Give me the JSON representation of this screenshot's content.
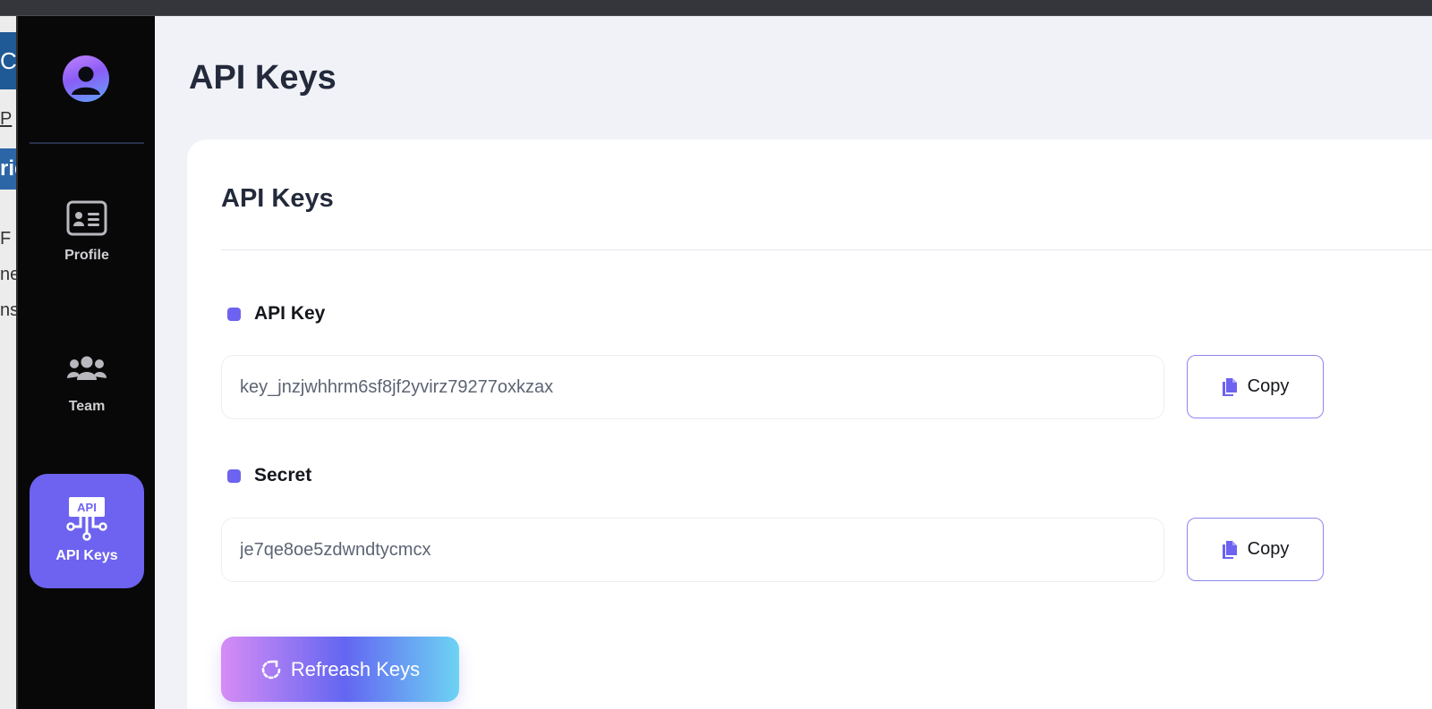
{
  "page": {
    "title": "API Keys"
  },
  "background_window": {
    "fragments": [
      "CO",
      "P",
      "rie",
      "F",
      "ne",
      "ns"
    ]
  },
  "sidebar": {
    "avatar_icon": "user-avatar-icon",
    "items": [
      {
        "label": "Profile",
        "icon": "id-card-icon",
        "active": false
      },
      {
        "label": "Team",
        "icon": "users-icon",
        "active": false
      },
      {
        "label": "API Keys",
        "icon": "api-icon",
        "icon_text": "API",
        "active": true
      }
    ]
  },
  "card": {
    "title": "API Keys",
    "fields": [
      {
        "label": "API Key",
        "value": "key_jnzjwhhrm6sf8jf2yvirz79277oxkzax",
        "copy_label": "Copy"
      },
      {
        "label": "Secret",
        "value": "je7qe8oe5zdwndtycmcx",
        "copy_label": "Copy"
      }
    ],
    "refresh_label": "Refreash Keys"
  },
  "colors": {
    "accent": "#6d63f0",
    "sidebar_bg": "#080808",
    "main_bg": "#f1f2f7",
    "card_bg": "#ffffff"
  }
}
